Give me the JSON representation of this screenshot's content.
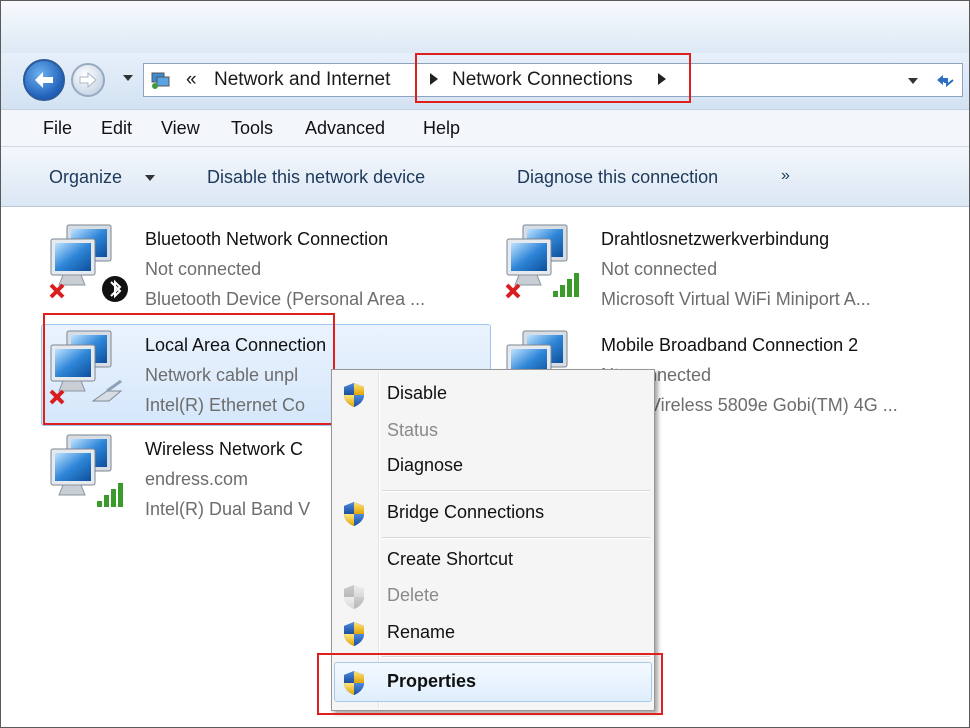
{
  "address": {
    "overflow": "«",
    "crumb1": "Network and Internet",
    "crumb2": "Network Connections"
  },
  "menu": [
    "File",
    "Edit",
    "View",
    "Tools",
    "Advanced",
    "Help"
  ],
  "toolbar": {
    "organize": "Organize",
    "disable": "Disable this network device",
    "diagnose": "Diagnose this connection",
    "more": "»"
  },
  "connections": [
    {
      "name": "Bluetooth Network Connection",
      "status": "Not connected",
      "device": "Bluetooth Device (Personal Area ..."
    },
    {
      "name": "Drahtlosnetzwerkverbindung",
      "status": "Not connected",
      "device": "Microsoft Virtual WiFi Miniport A..."
    },
    {
      "name": "Local Area Connection",
      "status": "Network cable unpl",
      "device": "Intel(R) Ethernet Co"
    },
    {
      "name": "Mobile Broadband Connection 2",
      "status": "Nt",
      "status_b": "onnected",
      "device": "Vireless 5809e Gobi(TM) 4G ..."
    },
    {
      "name": "Wireless Network C",
      "status": "endress.com",
      "device": "Intel(R) Dual Band V"
    }
  ],
  "context_menu": {
    "disable": "Disable",
    "status": "Status",
    "diagnose": "Diagnose",
    "bridge": "Bridge Connections",
    "shortcut": "Create Shortcut",
    "delete": "Delete",
    "rename": "Rename",
    "properties": "Properties"
  },
  "colors": {
    "highlight_box": "#e0201c",
    "accent": "#1e395b"
  }
}
